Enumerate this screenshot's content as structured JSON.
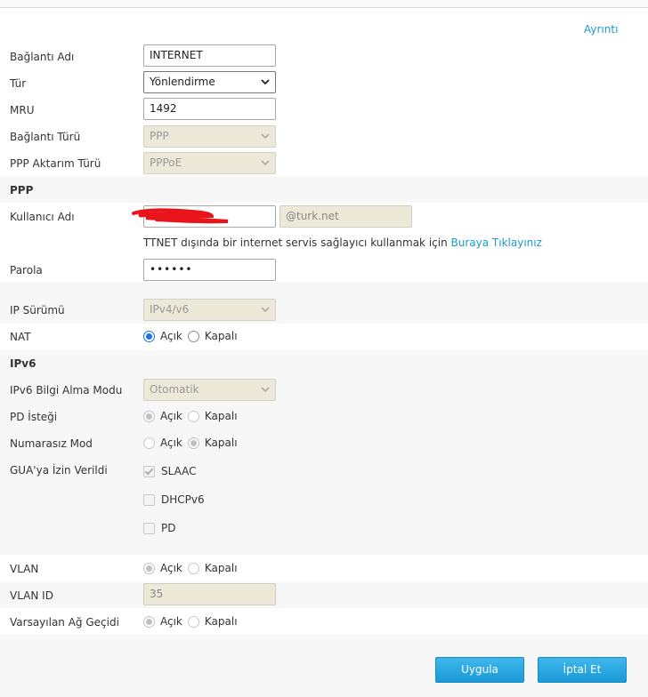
{
  "header": {
    "details_link": "Ayrıntı"
  },
  "connection": {
    "name_label": "Bağlantı Adı",
    "name_value": "INTERNET",
    "type_label": "Tür",
    "type_value": "Yönlendirme",
    "mru_label": "MRU",
    "mru_value": "1492",
    "conn_type_label": "Bağlantı Türü",
    "conn_type_value": "PPP",
    "ppp_transfer_label": "PPP Aktarım Türü",
    "ppp_transfer_value": "PPPoE"
  },
  "ppp": {
    "section_title": "PPP",
    "username_label": "Kullanıcı Adı",
    "username_value": "",
    "domain_value": "@turk.net",
    "hint_text": "TTNET dışında bir internet servis sağlayıcı kullanmak için",
    "hint_link": "Buraya Tıklayınız",
    "password_label": "Parola",
    "password_value": "••••••"
  },
  "ip": {
    "version_label": "IP Sürümü",
    "version_value": "IPv4/v6",
    "nat_label": "NAT",
    "on": "Açık",
    "off": "Kapalı"
  },
  "ipv6": {
    "section_title": "IPv6",
    "info_mode_label": "IPv6 Bilgi Alma Modu",
    "info_mode_value": "Otomatik",
    "pd_request_label": "PD İsteği",
    "unnumbered_label": "Numarasız Mod",
    "gua_label": "GUA'ya İzin Verildi",
    "slaac": "SLAAC",
    "dhcpv6": "DHCPv6",
    "pd": "PD"
  },
  "vlan": {
    "vlan_label": "VLAN",
    "vlan_id_label": "VLAN ID",
    "vlan_id_value": "35",
    "gateway_label": "Varsayılan Ağ Geçidi"
  },
  "actions": {
    "apply": "Uygula",
    "cancel": "İptal Et"
  },
  "colors": {
    "accent": "#1a9bd9",
    "link": "#1a9bd0",
    "radio_checked": "#1a73e8",
    "redaction": "#e8141a"
  }
}
